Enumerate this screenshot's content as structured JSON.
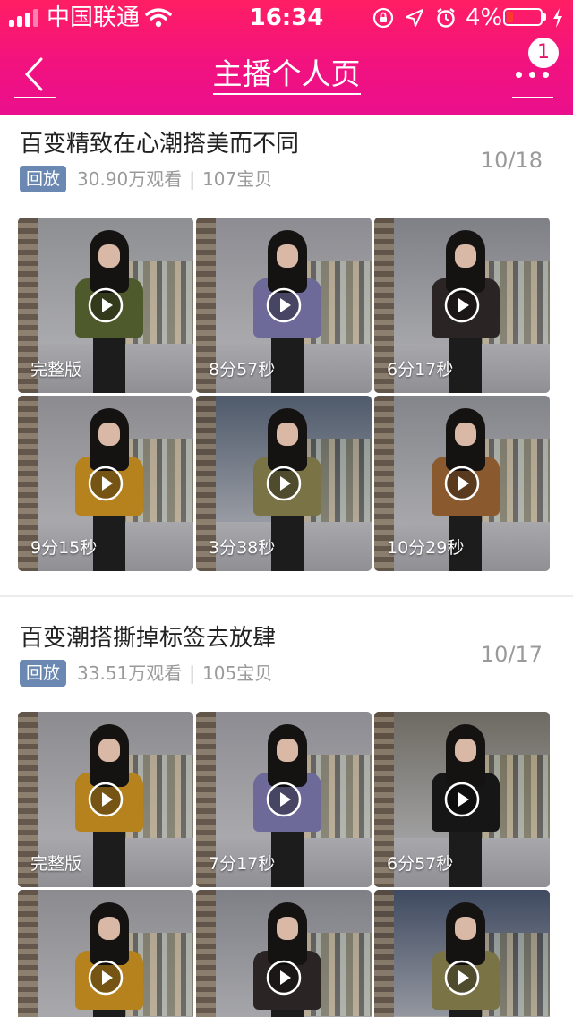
{
  "status_bar": {
    "carrier": "中国联通",
    "time": "16:34",
    "battery": "4%",
    "battery_level_fraction": 0.04,
    "icons": [
      "signal-icon",
      "wifi-icon",
      "orientation-lock-icon",
      "location-icon",
      "alarm-icon",
      "battery-icon",
      "charging-icon"
    ]
  },
  "nav": {
    "title": "主播个人页",
    "back_icon": "chevron-left-icon",
    "more_icon": "more-dots-icon",
    "badge_count": "1"
  },
  "colors": {
    "header_gradient_start": "#ff1e63",
    "header_gradient_end": "#ea0f8c",
    "replay_tag": "#6a88b2",
    "meta_text": "#9a9a9a"
  },
  "sections": [
    {
      "title": "百变精致在心潮搭美而不同",
      "date": "10/18",
      "tag": "回放",
      "views": "30.90万观看",
      "items": "107宝贝",
      "videos": [
        {
          "duration": "完整版",
          "top_color": "#4f5a2c",
          "bg": "#8e8f93"
        },
        {
          "duration": "8分57秒",
          "top_color": "#6d6a9a",
          "bg": "#8d8c92"
        },
        {
          "duration": "6分17秒",
          "top_color": "#2a2424",
          "bg": "#7f8086"
        },
        {
          "duration": "9分15秒",
          "top_color": "#b5821e",
          "bg": "#8b8b90"
        },
        {
          "duration": "3分38秒",
          "top_color": "#7a7346",
          "bg": "#4f5a6b"
        },
        {
          "duration": "10分29秒",
          "top_color": "#8a5a2e",
          "bg": "#84858a"
        }
      ]
    },
    {
      "title": "百变潮搭撕掉标签去放肆",
      "date": "10/17",
      "tag": "回放",
      "views": "33.51万观看",
      "items": "105宝贝",
      "videos": [
        {
          "duration": "完整版",
          "top_color": "#b5821e",
          "bg": "#8b8b90"
        },
        {
          "duration": "7分17秒",
          "top_color": "#6d6a9a",
          "bg": "#8d8c92"
        },
        {
          "duration": "6分57秒",
          "top_color": "#161616",
          "bg": "#6d6a62"
        },
        {
          "duration": "",
          "top_color": "#b5821e",
          "bg": "#8b8b90"
        },
        {
          "duration": "",
          "top_color": "#2a2424",
          "bg": "#7f8086"
        },
        {
          "duration": "",
          "top_color": "#7a7346",
          "bg": "#3f4a60"
        }
      ]
    }
  ]
}
